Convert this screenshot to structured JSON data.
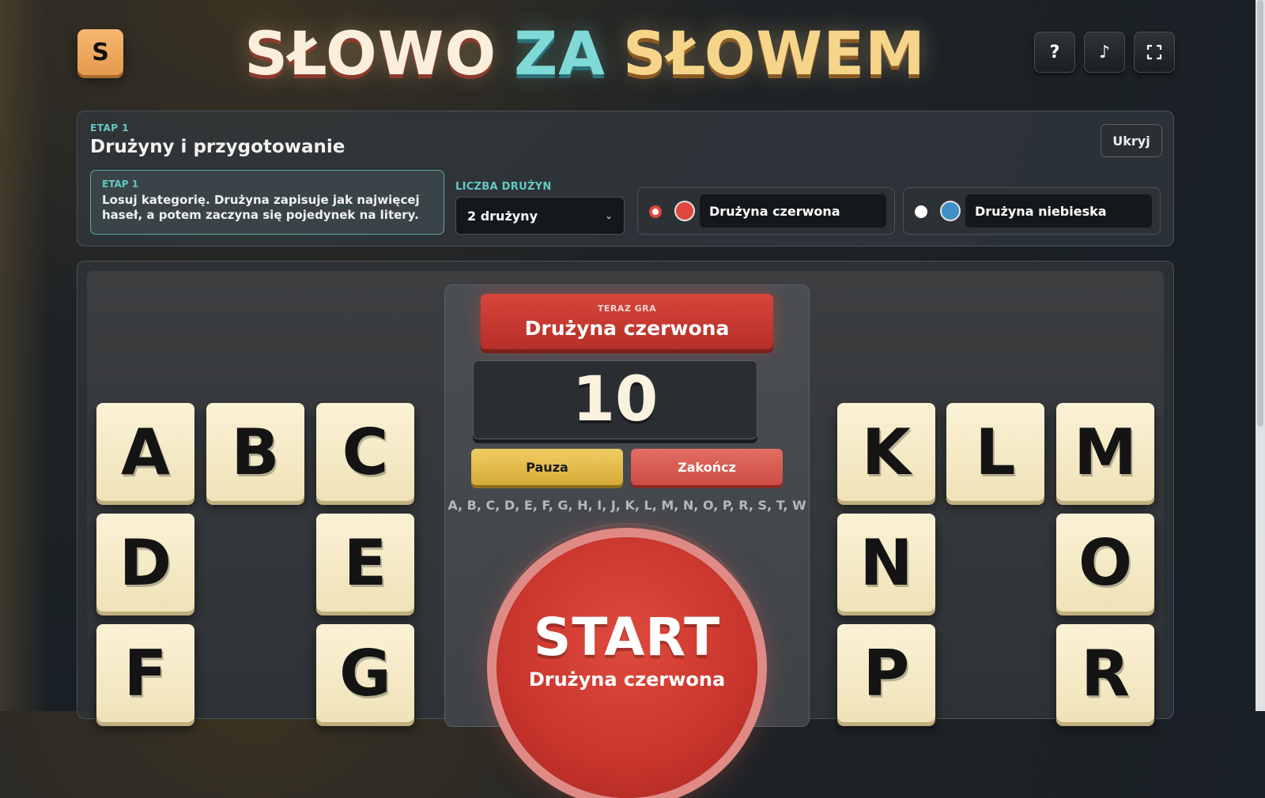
{
  "header": {
    "logo_letter": "S",
    "title_part1": "SŁOWO",
    "title_part2": "ZA",
    "title_part3": "SŁOWEM",
    "help_label": "?",
    "music_label": "♪",
    "fullscreen_label": "⛶"
  },
  "setup": {
    "stage_label": "ETAP 1",
    "stage_title": "Drużyny i przygotowanie",
    "hide_label": "Ukryj",
    "info_label": "ETAP 1",
    "info_text": "Losuj kategorię. Drużyna zapisuje jak najwięcej haseł, a potem zaczyna się pojedynek na litery.",
    "teams_label": "LICZBA DRUŻYN",
    "teams_value": "2 drużyny",
    "teams": [
      {
        "name": "Drużyna czerwona",
        "color": "#e0463d",
        "dot_color": "#ffffff",
        "dot_border": "#e0463d"
      },
      {
        "name": "Drużyna niebieska",
        "color": "#3f8fc7",
        "dot_color": "#ffffff",
        "dot_border": "#ffffff"
      }
    ]
  },
  "game": {
    "now_playing_label": "TERAZ GRA",
    "now_playing_team": "Drużyna czerwona",
    "timer": "10",
    "pause_label": "Pauza",
    "end_label": "Zakończ",
    "letters_line": "A, B, C, D, E, F, G, H, I, J, K, L, M, N, O, P, R, S, T, W",
    "start_label": "START",
    "start_team": "Drużyna czerwona"
  },
  "tiles": {
    "left": [
      "A",
      "B",
      "C",
      "D",
      "E",
      "F",
      "G"
    ],
    "right": [
      "K",
      "L",
      "M",
      "N",
      "O",
      "P",
      "R"
    ]
  }
}
